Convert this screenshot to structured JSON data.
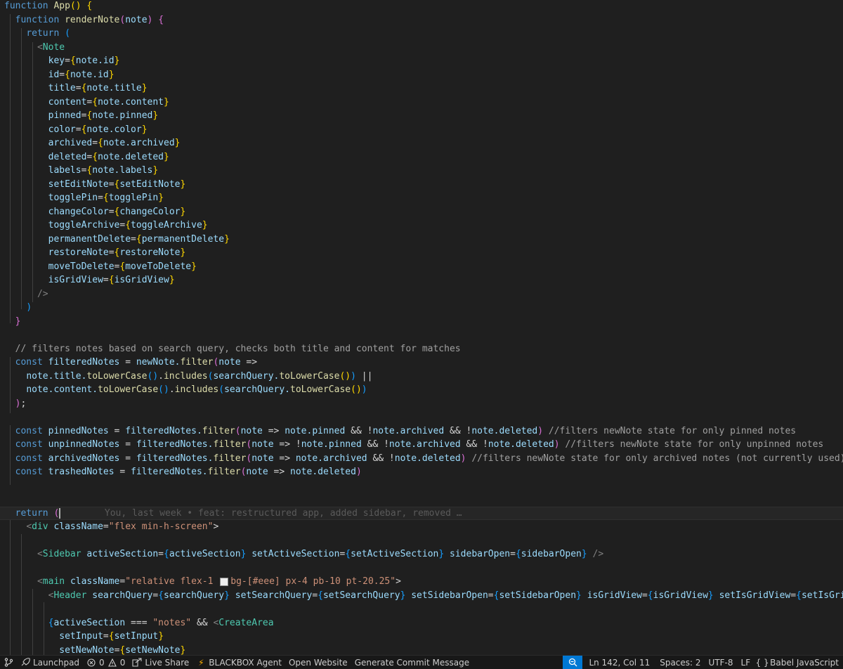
{
  "editor": {
    "lines": [
      "function App() {",
      "  function renderNote(note) {",
      "    return (",
      "      <Note",
      "        key={note.id}",
      "        id={note.id}",
      "        title={note.title}",
      "        content={note.content}",
      "        pinned={note.pinned}",
      "        color={note.color}",
      "        archived={note.archived}",
      "        deleted={note.deleted}",
      "        labels={note.labels}",
      "        setEditNote={setEditNote}",
      "        togglePin={togglePin}",
      "        changeColor={changeColor}",
      "        toggleArchive={toggleArchive}",
      "        permanentDelete={permanentDelete}",
      "        restoreNote={restoreNote}",
      "        moveToDelete={moveToDelete}",
      "        isGridView={isGridView}",
      "      />",
      "    )",
      "  }",
      "",
      "  // filters notes based on search query, checks both title and content for matches",
      "  const filteredNotes = newNote.filter(note =>",
      "    note.title.toLowerCase().includes(searchQuery.toLowerCase()) ||",
      "    note.content.toLowerCase().includes(searchQuery.toLowerCase())",
      "  );",
      "",
      "  const pinnedNotes = filteredNotes.filter(note => note.pinned && !note.archived && !note.deleted) //filters newNote state for only pinned notes",
      "  const unpinnedNotes = filteredNotes.filter(note => !note.pinned && !note.archived && !note.deleted) //filters newNote state for only unpinned notes",
      "  const archivedNotes = filteredNotes.filter(note => note.archived && !note.deleted) //filters newNote state for only archived notes (not currently used)",
      "  const trashedNotes = filteredNotes.filter(note => note.deleted)",
      "",
      "",
      "  return (",
      "    <div className=\"flex min-h-screen\">",
      "",
      "      <Sidebar activeSection={activeSection} setActiveSection={setActiveSection} sidebarOpen={sidebarOpen} />",
      "",
      "      <main className=\"relative flex-1 bg-[#eee] px-4 pb-10 pt-20.25\">",
      "        <Header searchQuery={searchQuery} setSearchQuery={setSearchQuery} setSidebarOpen={setSidebarOpen} isGridView={isGridView} setIsGridView={setIsGridView} />",
      "",
      "        {activeSection === \"notes\" && <CreateArea",
      "          setInput={setInput}",
      "          setNewNote={setNewNote}"
    ],
    "blame": "You, last week • feat: restructured app, added sidebar, removed …"
  },
  "statusbar": {
    "launchpad": "Launchpad",
    "errors": "0",
    "warnings": "0",
    "live_share": "Live Share",
    "blackbox": "BLACKBOX Agent",
    "open_website": "Open Website",
    "commit": "Generate Commit Message",
    "position": "Ln 142, Col 11",
    "spaces": "Spaces: 2",
    "encoding": "UTF-8",
    "eol": "LF",
    "language": "Babel JavaScript"
  },
  "colors": {
    "background": "#1f1f1f",
    "statusbar": "#181818",
    "zoom_accent": "#0078d4"
  }
}
